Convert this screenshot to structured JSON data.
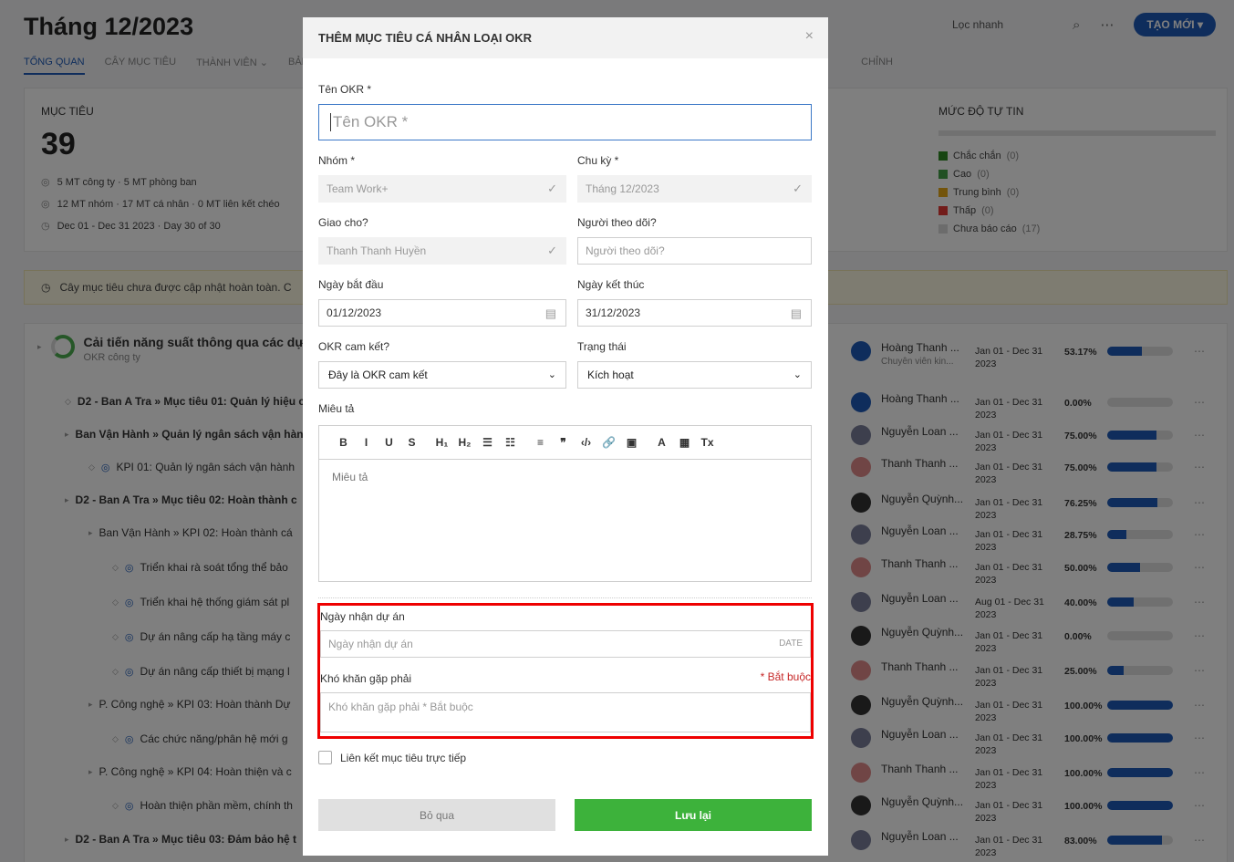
{
  "page": {
    "title": "Tháng 12/2023",
    "quick_filter": "Lọc nhanh",
    "create_label": "TẠO MỚI",
    "tabs": [
      "TỔNG QUAN",
      "CÂY MỤC TIÊU",
      "THÀNH VIÊN",
      "BẢNG",
      "CHỈNH"
    ]
  },
  "summary": {
    "label": "MỤC TIÊU",
    "count": "39",
    "line1": "5 MT công ty · 5 MT phòng ban",
    "line2": "12 MT nhóm · 17 MT cá nhân · 0 MT liên kết chéo",
    "line3": "Dec 01 - Dec 31 2023 · Day 30 of 30",
    "confidence_title": "MỨC ĐỘ TỰ TIN",
    "confidence": [
      {
        "label": "Chắc chắn",
        "count": "(0)",
        "color": "#2e8b22"
      },
      {
        "label": "Cao",
        "count": "(0)",
        "color": "#43a047"
      },
      {
        "label": "Trung bình",
        "count": "(0)",
        "color": "#e6a817"
      },
      {
        "label": "Thấp",
        "count": "(0)",
        "color": "#e53935"
      },
      {
        "label": "Chưa báo cáo",
        "count": "(17)",
        "color": "#d8d8d8"
      }
    ]
  },
  "notice": "Cây mục tiêu chưa được cập nhật hoàn toàn. C",
  "tree": {
    "root_title": "Cải tiến năng suất thông qua các dự á",
    "root_sub": "OKR công ty",
    "rows": [
      "D2 - Ban A Tra » Mục tiêu 01: Quản lý hiệu c",
      "Ban Vận Hành » Quản lý ngân sách vận hàn",
      "KPI 01: Quản lý ngân sách vận hành",
      "D2 - Ban A Tra » Mục tiêu 02: Hoàn thành c",
      "Ban Vận Hành » KPI 02: Hoàn thành cá",
      "Triển khai rà soát tổng thể bảo",
      "Triển khai hệ thống giám sát pl",
      "Dự án nâng cấp hạ tầng máy c",
      "Dự án nâng cấp thiết bị mạng l",
      "P. Công nghệ » KPI 03: Hoàn thành Dự",
      "Các chức năng/phân hệ mới g",
      "P. Công nghệ » KPI 04: Hoàn thiện và c",
      "Hoàn thiện phần mềm, chính th",
      "D2 - Ban A Tra » Mục tiêu 03: Đảm bảo hệ t"
    ]
  },
  "owners": [
    {
      "name": "Hoàng Thanh ...",
      "sub": "Chuyên viên kin...",
      "dates": "Jan 01 - Dec 31 2023",
      "pct": "53.17%",
      "progress": 0.5317,
      "avatar_color": "#1e5bb8"
    },
    {
      "name": "Hoàng Thanh ...",
      "sub": "",
      "dates": "Jan 01 - Dec 31 2023",
      "pct": "0.00%",
      "progress": 0,
      "avatar_color": "#1e5bb8"
    },
    {
      "name": "Nguyễn Loan ...",
      "sub": "",
      "dates": "Jan 01 - Dec 31 2023",
      "pct": "75.00%",
      "progress": 0.75,
      "avatar_color": "#7a7f9a"
    },
    {
      "name": "Thanh Thanh ...",
      "sub": "",
      "dates": "Jan 01 - Dec 31 2023",
      "pct": "75.00%",
      "progress": 0.75,
      "avatar_color": "#e08a8a"
    },
    {
      "name": "Nguyễn Quỳnh...",
      "sub": "",
      "dates": "Jan 01 - Dec 31 2023",
      "pct": "76.25%",
      "progress": 0.7625,
      "avatar_color": "#333333"
    },
    {
      "name": "Nguyễn Loan ...",
      "sub": "",
      "dates": "Jan 01 - Dec 31 2023",
      "pct": "28.75%",
      "progress": 0.2875,
      "avatar_color": "#7a7f9a"
    },
    {
      "name": "Thanh Thanh ...",
      "sub": "",
      "dates": "Jan 01 - Dec 31 2023",
      "pct": "50.00%",
      "progress": 0.5,
      "avatar_color": "#e08a8a"
    },
    {
      "name": "Nguyễn Loan ...",
      "sub": "",
      "dates": "Aug 01 - Dec 31 2023",
      "pct": "40.00%",
      "progress": 0.4,
      "avatar_color": "#7a7f9a"
    },
    {
      "name": "Nguyễn Quỳnh...",
      "sub": "",
      "dates": "Jan 01 - Dec 31 2023",
      "pct": "0.00%",
      "progress": 0,
      "avatar_color": "#333333"
    },
    {
      "name": "Thanh Thanh ...",
      "sub": "",
      "dates": "Jan 01 - Dec 31 2023",
      "pct": "25.00%",
      "progress": 0.25,
      "avatar_color": "#e08a8a"
    },
    {
      "name": "Nguyễn Quỳnh...",
      "sub": "",
      "dates": "Jan 01 - Dec 31 2023",
      "pct": "100.00%",
      "progress": 1,
      "avatar_color": "#333333"
    },
    {
      "name": "Nguyễn Loan ...",
      "sub": "",
      "dates": "Jan 01 - Dec 31 2023",
      "pct": "100.00%",
      "progress": 1,
      "avatar_color": "#7a7f9a"
    },
    {
      "name": "Thanh Thanh ...",
      "sub": "",
      "dates": "Jan 01 - Dec 31 2023",
      "pct": "100.00%",
      "progress": 1,
      "avatar_color": "#e08a8a"
    },
    {
      "name": "Nguyễn Quỳnh...",
      "sub": "",
      "dates": "Jan 01 - Dec 31 2023",
      "pct": "100.00%",
      "progress": 1,
      "avatar_color": "#333333"
    },
    {
      "name": "Nguyễn Loan ...",
      "sub": "",
      "dates": "Jan 01 - Dec 31 2023",
      "pct": "83.00%",
      "progress": 0.83,
      "avatar_color": "#7a7f9a"
    }
  ],
  "modal": {
    "title": "THÊM MỤC TIÊU CÁ NHÂN LOẠI OKR",
    "close": "×",
    "okr_name_label": "Tên OKR *",
    "okr_name_placeholder": "Tên OKR *",
    "group_label": "Nhóm *",
    "group_value": "Team Work+",
    "cycle_label": "Chu kỳ *",
    "cycle_value": "Tháng 12/2023",
    "assignee_label": "Giao cho?",
    "assignee_value": "Thanh Thanh Huyền",
    "follower_label": "Người theo dõi?",
    "follower_placeholder": "Người theo dõi?",
    "start_label": "Ngày bắt đầu",
    "start_value": "01/12/2023",
    "end_label": "Ngày kết thúc",
    "end_value": "31/12/2023",
    "commit_label": "OKR cam kết?",
    "commit_value": "Đây là OKR cam kết",
    "status_label": "Trạng thái",
    "status_value": "Kích hoạt",
    "desc_label": "Miêu tả",
    "desc_placeholder": "Miêu tả",
    "toolbar": [
      "B",
      "I",
      "U",
      "S",
      "H₁",
      "H₂",
      "☰",
      "☷",
      "≡",
      "❞",
      "‹/›",
      "🔗",
      "▣",
      "A",
      "▦",
      "Tx"
    ],
    "project_date_label": "Ngày nhận dự án",
    "project_date_placeholder": "Ngày nhận dự án",
    "project_date_tag": "DATE",
    "difficulty_label": "Khó khăn gặp phải",
    "difficulty_required": "* Bắt buộc",
    "difficulty_placeholder": "Khó khăn gặp phải * Bắt buộc",
    "link_label": "Liên kết mục tiêu trực tiếp",
    "cancel_label": "Bỏ qua",
    "save_label": "Lưu lại"
  }
}
